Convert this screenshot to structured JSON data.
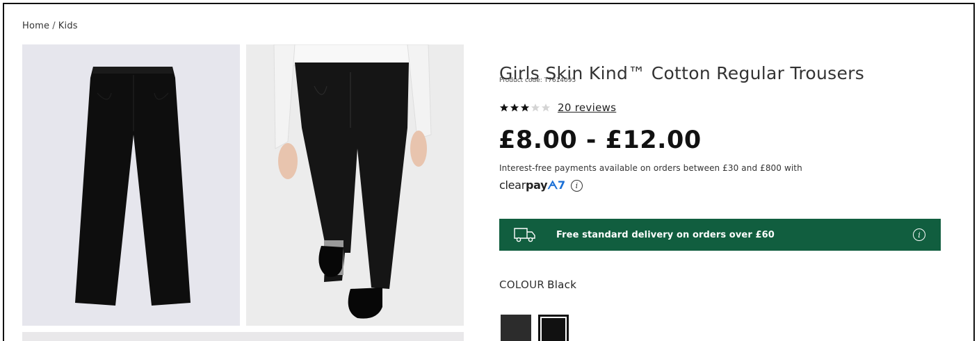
{
  "breadcrumb": {
    "home": "Home",
    "separator": "/",
    "current": "Kids"
  },
  "product": {
    "title": "Girls Skin Kind™ Cotton Regular Trousers",
    "code": "Product code: T7614095",
    "rating": {
      "stars_filled": 3,
      "stars_total": 5
    },
    "reviews_label": "20 reviews",
    "price": "£8.00 - £12.00"
  },
  "payments": {
    "text": "Interest-free payments available on orders between £30 and £800 with",
    "logo_regular": "clear",
    "logo_bold": "pay",
    "logo_mark": "ᗅ7",
    "info_glyph": "i"
  },
  "delivery": {
    "text": "Free standard delivery on orders over £60",
    "info_glyph": "i",
    "color": "#115e3f"
  },
  "colour": {
    "label": "COLOUR",
    "value": "Black",
    "swatches": [
      "grey-swatch",
      "black-swatch"
    ]
  },
  "icons": [
    "truck-icon",
    "info-icon",
    "star-icon"
  ]
}
